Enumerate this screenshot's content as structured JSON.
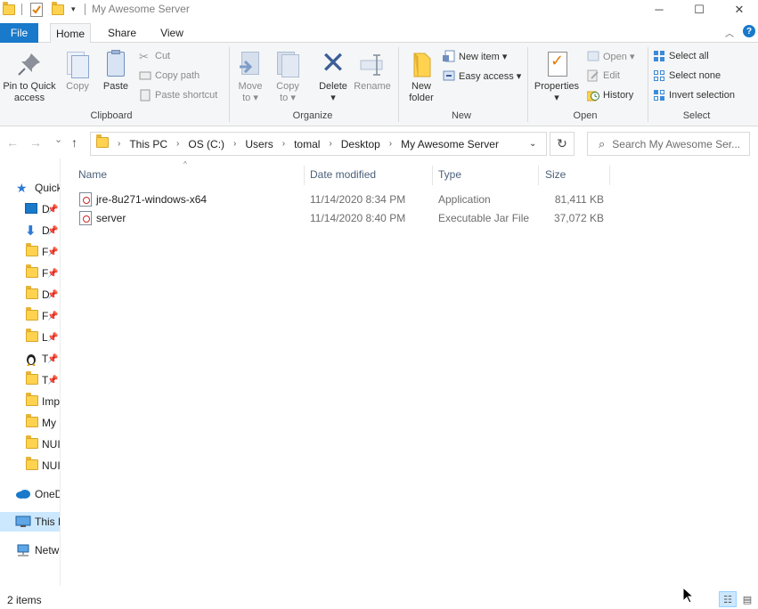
{
  "window": {
    "title": "My Awesome Server",
    "minimize_glyph": "─",
    "maximize_glyph": "☐",
    "close_glyph": "✕"
  },
  "quick_access_toolbar": {
    "customize_glyph": "▾"
  },
  "ribbon_tabs": {
    "file": "File",
    "home": "Home",
    "share": "Share",
    "view": "View",
    "collapse_glyph": "︿",
    "help_glyph": "?"
  },
  "clipboard": {
    "label": "Clipboard",
    "pin_to_quick_access": [
      "Pin to Quick",
      "access"
    ],
    "copy": "Copy",
    "paste": "Paste",
    "cut": "Cut",
    "copy_path": "Copy path",
    "paste_shortcut": "Paste shortcut"
  },
  "organize": {
    "label": "Organize",
    "move_to": [
      "Move",
      "to ▾"
    ],
    "copy_to": [
      "Copy",
      "to ▾"
    ],
    "delete": [
      "Delete",
      "▾"
    ],
    "rename": "Rename"
  },
  "new_group": {
    "label": "New",
    "new_folder": [
      "New",
      "folder"
    ],
    "new_item": "New item ▾",
    "easy_access": "Easy access ▾"
  },
  "open_group": {
    "label": "Open",
    "properties": [
      "Properties",
      "▾"
    ],
    "open": "Open ▾",
    "edit": "Edit",
    "history": "History"
  },
  "select_group": {
    "label": "Select",
    "select_all": "Select all",
    "select_none": "Select none",
    "invert_selection": "Invert selection"
  },
  "navigation": {
    "back_glyph": "←",
    "forward_glyph": "→",
    "recent_glyph": "⌄",
    "up_glyph": "↑",
    "refresh_glyph": "↻",
    "dropdown_glyph": "⌄",
    "breadcrumb": [
      "This PC",
      "OS (C:)",
      "Users",
      "tomal",
      "Desktop",
      "My Awesome Server"
    ],
    "breadcrumb_separator": "›",
    "search_placeholder": "Search My Awesome Ser...",
    "search_glyph": "⌕"
  },
  "nav_pane": {
    "items": [
      {
        "label": "Quick",
        "icon": "star-icon",
        "pinned": false
      },
      {
        "label": "D",
        "icon": "desktop-icon",
        "pinned": true
      },
      {
        "label": "D",
        "icon": "download-icon",
        "pinned": true
      },
      {
        "label": "F",
        "icon": "folder-icon",
        "pinned": true
      },
      {
        "label": "F",
        "icon": "folder-icon",
        "pinned": true
      },
      {
        "label": "D",
        "icon": "folder-icon",
        "pinned": true
      },
      {
        "label": "F",
        "icon": "folder-icon",
        "pinned": true
      },
      {
        "label": "L",
        "icon": "folder-icon",
        "pinned": true
      },
      {
        "label": "T",
        "icon": "penguin-icon",
        "pinned": true
      },
      {
        "label": "T",
        "icon": "folder-icon",
        "pinned": true
      },
      {
        "label": "Imp",
        "icon": "folder-icon",
        "pinned": false
      },
      {
        "label": "My",
        "icon": "folder-icon",
        "pinned": false
      },
      {
        "label": "NUI",
        "icon": "folder-icon",
        "pinned": false
      },
      {
        "label": "NUI",
        "icon": "folder-icon",
        "pinned": false
      },
      {
        "label": "OneD",
        "icon": "cloud-icon",
        "pinned": false
      },
      {
        "label": "This P",
        "icon": "computer-icon",
        "pinned": false
      },
      {
        "label": "Netw",
        "icon": "network-icon",
        "pinned": false
      }
    ],
    "pin_glyph": "📌"
  },
  "file_list": {
    "columns": [
      "Name",
      "Date modified",
      "Type",
      "Size"
    ],
    "sort_glyph": "^",
    "rows": [
      {
        "name": "jre-8u271-windows-x64",
        "date": "11/14/2020 8:34 PM",
        "type": "Application",
        "size": "81,411 KB"
      },
      {
        "name": "server",
        "date": "11/14/2020 8:40 PM",
        "type": "Executable Jar File",
        "size": "37,072 KB"
      }
    ]
  },
  "status_bar": {
    "item_count": "2 items",
    "details_view_glyph": "☷",
    "tiles_view_glyph": "▤"
  },
  "colors": {
    "file_tab": "#1979ca",
    "selection": "#cce8ff",
    "folder": "#ffd34f"
  }
}
